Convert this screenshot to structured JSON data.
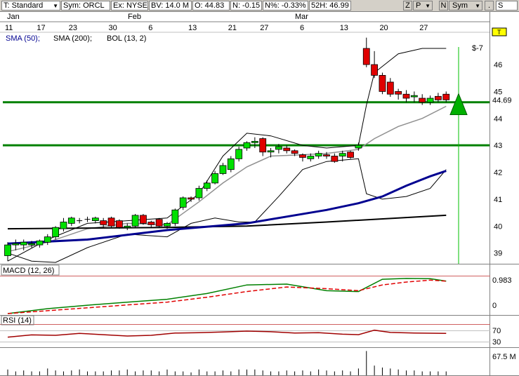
{
  "toolbar": {
    "template": "T: Standard",
    "symbol": "Sym: ORCL",
    "exchange": "Ex: NYSE",
    "bv": "BV: 14.0 M",
    "open": "O: 44.83",
    "net": "N: -0.15",
    "net_pct": "N%: -0.33%",
    "high52": "52H: 46.99",
    "btn_z": "Z",
    "btn_p": "P",
    "btn_n": "N",
    "btn_sym": "Sym",
    "btn_dot": ".",
    "btn_s": "S"
  },
  "months": [
    {
      "label": "Jan"
    },
    {
      "label": "Feb"
    },
    {
      "label": "Mar"
    }
  ],
  "dates": [
    "11",
    "17",
    "23",
    "30",
    "6",
    "13",
    "21",
    "27",
    "6",
    "13",
    "20",
    "27"
  ],
  "indicators": {
    "sma50": "SMA (50);",
    "sma200": "SMA (200);",
    "bol": "BOL (13, 2)"
  },
  "price_axis": [
    "46",
    "45",
    "44",
    "43",
    "42",
    "41",
    "40",
    "39"
  ],
  "current_price": "44.69",
  "flag": "$-7",
  "t_marker": "T",
  "macd": {
    "label": "MACD (12, 26)",
    "axis": [
      "0.983",
      "0"
    ]
  },
  "rsi": {
    "label": "RSI (14)",
    "axis": [
      "70",
      "30"
    ]
  },
  "volume": {
    "axis": "67.5 M"
  },
  "colors": {
    "up": "#00e000",
    "down": "#e00000",
    "support": "#008000",
    "sma50": "#000090",
    "sma200": "#000000",
    "bollinger": "#000000",
    "macd": "#008000",
    "macd_signal": "#e00000",
    "rsi": "#a00000",
    "marker": "#00c000"
  },
  "chart_data": {
    "type": "candlestick",
    "x": [
      "Jan 11",
      "Jan 12",
      "Jan 13",
      "Jan 14",
      "Jan 15",
      "Jan 18",
      "Jan 19",
      "Jan 20",
      "Jan 21",
      "Jan 22",
      "Jan 25",
      "Jan 26",
      "Jan 27",
      "Jan 28",
      "Jan 29",
      "Feb 1",
      "Feb 2",
      "Feb 3",
      "Feb 4",
      "Feb 5",
      "Feb 8",
      "Feb 9",
      "Feb 10",
      "Feb 11",
      "Feb 12",
      "Feb 16",
      "Feb 17",
      "Feb 18",
      "Feb 19",
      "Feb 22",
      "Feb 23",
      "Feb 24",
      "Feb 25",
      "Feb 26",
      "Mar 1",
      "Mar 2",
      "Mar 3",
      "Mar 4",
      "Mar 5",
      "Mar 8",
      "Mar 9",
      "Mar 10",
      "Mar 11",
      "Mar 12",
      "Mar 15",
      "Mar 16",
      "Mar 17",
      "Mar 18",
      "Mar 19",
      "Mar 22",
      "Mar 23",
      "Mar 24",
      "Mar 25",
      "Mar 26",
      "Mar 29",
      "Mar 30"
    ],
    "open": [
      38.9,
      39.3,
      39.3,
      39.3,
      39.3,
      39.4,
      39.6,
      39.9,
      40.1,
      40.2,
      40.25,
      40.2,
      40.2,
      40.3,
      40.2,
      39.95,
      40.0,
      40.4,
      40.15,
      40.25,
      40.0,
      40.1,
      40.7,
      41.05,
      41.05,
      41.4,
      41.6,
      41.95,
      42.1,
      42.5,
      42.9,
      43.1,
      43.25,
      42.75,
      42.85,
      42.9,
      42.8,
      42.65,
      42.5,
      42.6,
      42.65,
      42.6,
      42.6,
      42.75,
      42.9,
      46.6,
      46.0,
      45.6,
      45.35,
      45.0,
      44.9,
      44.8,
      44.75,
      44.6,
      44.82,
      44.9
    ],
    "close": [
      39.3,
      39.35,
      39.4,
      39.35,
      39.45,
      39.6,
      39.95,
      40.15,
      40.3,
      40.2,
      40.25,
      40.3,
      40.05,
      40.0,
      39.95,
      40.0,
      40.4,
      40.1,
      40.05,
      40.0,
      40.1,
      40.6,
      41.05,
      41.0,
      41.4,
      41.6,
      41.95,
      42.25,
      42.5,
      42.85,
      43.1,
      43.15,
      42.75,
      42.8,
      42.95,
      42.8,
      42.7,
      42.55,
      42.6,
      42.7,
      42.6,
      42.4,
      42.7,
      42.55,
      43.0,
      46.0,
      45.6,
      45.0,
      44.9,
      44.9,
      44.75,
      44.85,
      44.6,
      44.75,
      44.69,
      44.69
    ],
    "high": [
      39.4,
      39.5,
      39.5,
      39.45,
      39.5,
      39.7,
      40.0,
      40.3,
      40.35,
      40.3,
      40.35,
      40.35,
      40.3,
      40.35,
      40.25,
      40.1,
      40.45,
      40.45,
      40.2,
      40.3,
      40.15,
      40.65,
      41.1,
      41.1,
      41.5,
      41.7,
      42.05,
      42.35,
      42.6,
      42.95,
      43.15,
      43.3,
      43.3,
      42.9,
      43.05,
      43.0,
      42.85,
      42.7,
      42.7,
      42.8,
      42.75,
      42.7,
      42.8,
      42.8,
      43.1,
      47.0,
      46.5,
      45.7,
      45.5,
      45.1,
      45.05,
      45.0,
      44.9,
      44.85,
      44.95,
      45.0
    ],
    "low": [
      38.7,
      39.1,
      39.1,
      39.2,
      39.2,
      39.3,
      39.5,
      39.8,
      40.0,
      40.1,
      40.15,
      40.1,
      39.95,
      39.95,
      39.9,
      39.85,
      39.95,
      40.05,
      39.95,
      39.95,
      39.9,
      40.0,
      40.6,
      40.9,
      40.95,
      41.3,
      41.55,
      41.9,
      42.0,
      42.4,
      42.8,
      42.9,
      42.6,
      42.55,
      42.7,
      42.7,
      42.6,
      42.4,
      42.4,
      42.5,
      42.5,
      42.35,
      42.4,
      42.5,
      42.8,
      45.9,
      45.5,
      44.9,
      44.8,
      44.7,
      44.6,
      44.6,
      44.5,
      44.5,
      44.6,
      44.6
    ],
    "volume": [
      6,
      4,
      5,
      4,
      4,
      7,
      5,
      4,
      5,
      6,
      4,
      4,
      4,
      5,
      5,
      6,
      4,
      5,
      5,
      4,
      6,
      4,
      4,
      3,
      6,
      4,
      4,
      5,
      4,
      6,
      6,
      6,
      5,
      4,
      4,
      5,
      4,
      5,
      4,
      6,
      5,
      4,
      5,
      4,
      7,
      25,
      10,
      8,
      7,
      6,
      5,
      5,
      4,
      4,
      4,
      4
    ],
    "support_levels": [
      44.6,
      43.0
    ],
    "y_range": [
      38.6,
      47.2
    ],
    "current_price": 44.69,
    "sma50": [
      [
        0,
        39.35
      ],
      [
        10,
        39.5
      ],
      [
        20,
        39.85
      ],
      [
        30,
        40.1
      ],
      [
        35,
        40.35
      ],
      [
        40,
        40.6
      ],
      [
        44,
        40.85
      ],
      [
        47,
        41.1
      ],
      [
        50,
        41.5
      ],
      [
        53,
        41.85
      ],
      [
        55,
        42.05
      ]
    ],
    "sma200": [
      [
        0,
        39.9
      ],
      [
        20,
        39.95
      ],
      [
        30,
        40.0
      ],
      [
        40,
        40.15
      ],
      [
        55,
        40.4
      ]
    ],
    "bb_upper": [
      [
        0,
        38.7
      ],
      [
        5,
        39.5
      ],
      [
        10,
        40.1
      ],
      [
        15,
        40.2
      ],
      [
        20,
        40.3
      ],
      [
        24,
        41.2
      ],
      [
        27,
        42.6
      ],
      [
        30,
        43.45
      ],
      [
        33,
        43.35
      ],
      [
        37,
        43.0
      ],
      [
        40,
        42.9
      ],
      [
        44,
        43.0
      ],
      [
        45,
        44.5
      ],
      [
        46,
        45.7
      ],
      [
        49,
        46.4
      ],
      [
        52,
        46.6
      ],
      [
        55,
        46.6
      ]
    ],
    "bb_middle": [
      [
        0,
        39.05
      ],
      [
        5,
        39.4
      ],
      [
        10,
        39.9
      ],
      [
        15,
        40.1
      ],
      [
        20,
        40.05
      ],
      [
        24,
        40.9
      ],
      [
        27,
        41.6
      ],
      [
        30,
        42.2
      ],
      [
        33,
        42.6
      ],
      [
        37,
        42.65
      ],
      [
        40,
        42.7
      ],
      [
        44,
        42.85
      ],
      [
        46,
        43.25
      ],
      [
        49,
        43.7
      ],
      [
        52,
        44.0
      ],
      [
        55,
        44.45
      ]
    ],
    "bb_lower": [
      [
        0,
        39.0
      ],
      [
        3,
        38.7
      ],
      [
        6,
        38.65
      ],
      [
        10,
        39.2
      ],
      [
        15,
        39.7
      ],
      [
        20,
        39.6
      ],
      [
        23,
        40.1
      ],
      [
        26,
        40.3
      ],
      [
        29,
        40.15
      ],
      [
        31,
        40.15
      ],
      [
        34,
        41.1
      ],
      [
        37,
        42.1
      ],
      [
        40,
        42.4
      ],
      [
        44,
        42.5
      ],
      [
        45,
        41.2
      ],
      [
        47,
        41.0
      ],
      [
        50,
        41.1
      ],
      [
        53,
        41.4
      ],
      [
        55,
        42.1
      ]
    ],
    "macd": [
      [
        0,
        -0.15
      ],
      [
        5,
        0.02
      ],
      [
        10,
        0.14
      ],
      [
        15,
        0.25
      ],
      [
        20,
        0.35
      ],
      [
        25,
        0.55
      ],
      [
        30,
        0.85
      ],
      [
        35,
        0.88
      ],
      [
        40,
        0.65
      ],
      [
        44,
        0.62
      ],
      [
        47,
        1.05
      ],
      [
        50,
        1.08
      ],
      [
        53,
        1.07
      ],
      [
        55,
        0.983
      ]
    ],
    "macd_signal": [
      [
        0,
        -0.15
      ],
      [
        5,
        -0.05
      ],
      [
        10,
        0.05
      ],
      [
        15,
        0.15
      ],
      [
        20,
        0.25
      ],
      [
        25,
        0.42
      ],
      [
        30,
        0.62
      ],
      [
        35,
        0.78
      ],
      [
        40,
        0.72
      ],
      [
        44,
        0.65
      ],
      [
        47,
        0.85
      ],
      [
        50,
        0.95
      ],
      [
        53,
        1.02
      ],
      [
        55,
        0.983
      ]
    ],
    "rsi": [
      [
        0,
        45
      ],
      [
        3,
        55
      ],
      [
        6,
        53
      ],
      [
        9,
        62
      ],
      [
        12,
        56
      ],
      [
        15,
        50
      ],
      [
        18,
        53
      ],
      [
        21,
        63
      ],
      [
        24,
        65
      ],
      [
        27,
        68
      ],
      [
        30,
        72
      ],
      [
        33,
        69
      ],
      [
        36,
        63
      ],
      [
        39,
        65
      ],
      [
        42,
        58
      ],
      [
        44,
        56
      ],
      [
        46,
        76
      ],
      [
        48,
        66
      ],
      [
        51,
        63
      ],
      [
        55,
        62
      ]
    ]
  }
}
